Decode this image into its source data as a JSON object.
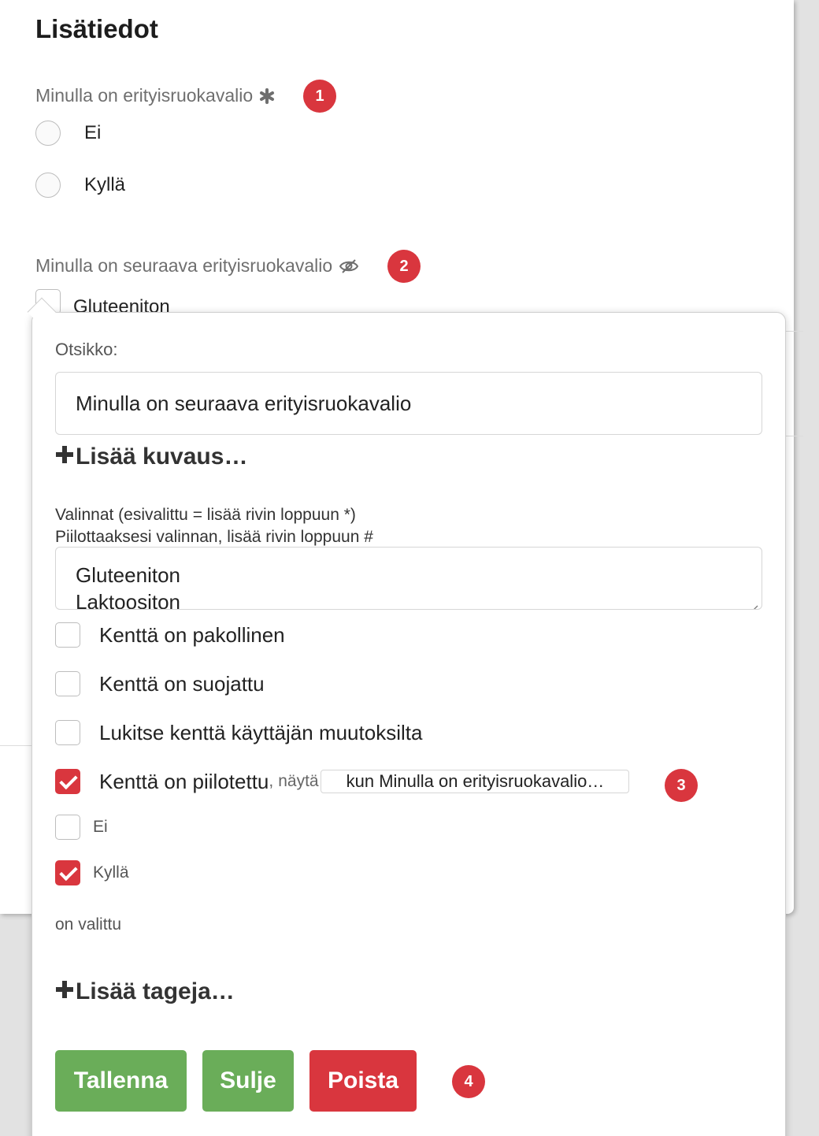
{
  "page": {
    "title": "Lisätiedot"
  },
  "fields": {
    "diet": {
      "label": "Minulla on erityisruokavalio",
      "required_icon": "asterisk-icon",
      "options": [
        "Ei",
        "Kyllä"
      ],
      "badge": "1"
    },
    "diet_choice": {
      "label": "Minulla on seuraava erityisruokavalio",
      "hidden_icon": "eye-slash-icon",
      "first_option": "Gluteeniton",
      "badge": "2"
    }
  },
  "editor": {
    "title_label": "Otsikko:",
    "title_value": "Minulla on seuraava erityisruokavalio",
    "add_description": "Lisää kuvaus…",
    "choices_hint_1": "Valinnat (esivalittu = lisää rivin loppuun *)",
    "choices_hint_2": "Piilottaaksesi valinnan, lisää rivin loppuun #",
    "choices_lines": [
      "Gluteeniton",
      "Laktoositon"
    ],
    "options": {
      "required": {
        "label": "Kenttä on pakollinen",
        "checked": false
      },
      "protected": {
        "label": "Kenttä on suojattu",
        "checked": false
      },
      "locked": {
        "label": "Lukitse kenttä käyttäjän muutoksilta",
        "checked": false
      },
      "hidden": {
        "label": "Kenttä on piilotettu",
        "comma": ",",
        "show_text": "näytä",
        "condition": "kun Minulla on erityisruokavalio…",
        "checked": true,
        "badge": "3"
      }
    },
    "condition_values": [
      {
        "label": "Ei",
        "checked": false
      },
      {
        "label": "Kyllä",
        "checked": true
      }
    ],
    "selected_text": "on valittu",
    "add_tags": "Lisää tageja…",
    "buttons": {
      "save": "Tallenna",
      "close": "Sulje",
      "delete": "Poista",
      "badge": "4"
    }
  },
  "colors": {
    "green": "#6aad59",
    "red": "#d9363e"
  }
}
